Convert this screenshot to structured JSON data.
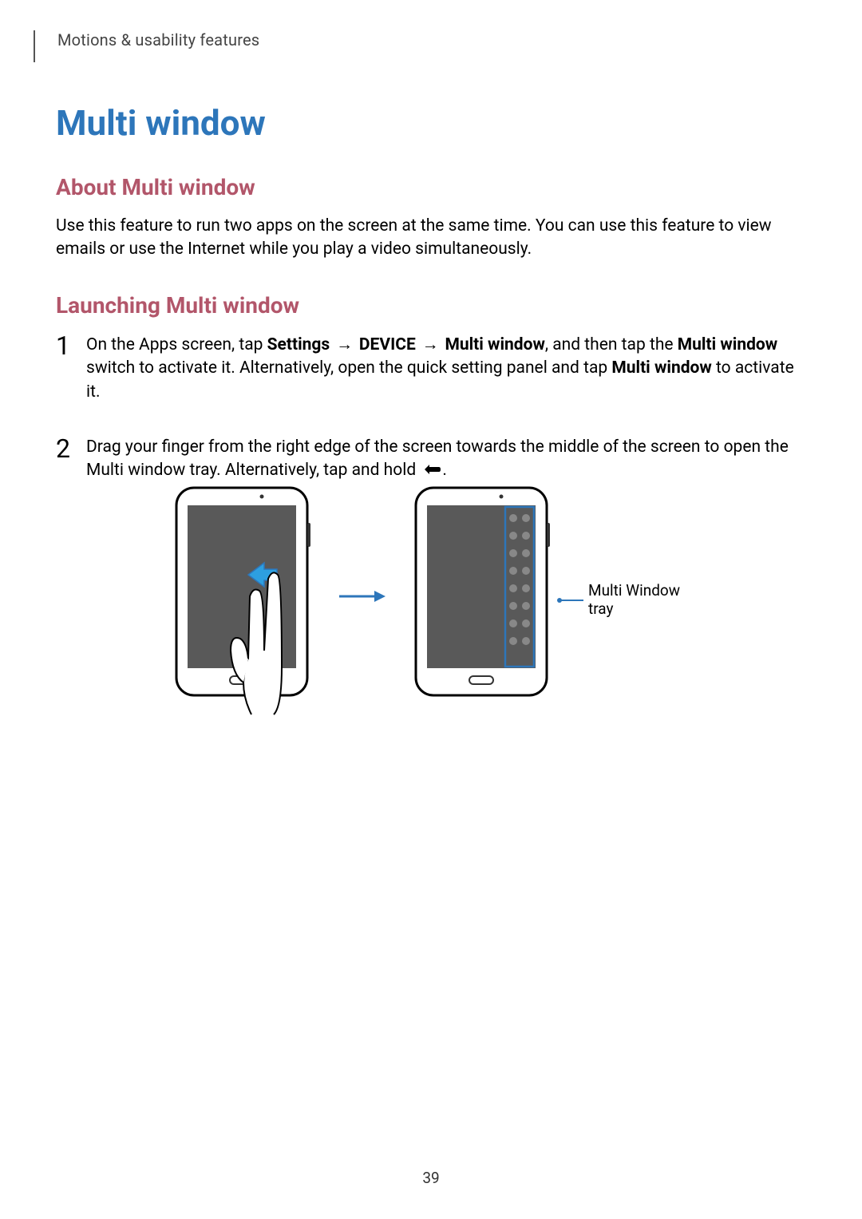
{
  "header": {
    "breadcrumb": "Motions & usability features"
  },
  "title": "Multi window",
  "sections": {
    "about": {
      "heading": "About Multi window",
      "body": "Use this feature to run two apps on the screen at the same time. You can use this feature to view emails or use the Internet while you play a video simultaneously."
    },
    "launching": {
      "heading": "Launching Multi window",
      "steps": {
        "s1": {
          "t0": "On the Apps screen, tap ",
          "b0": "Settings",
          "t1": " → ",
          "b1": "DEVICE",
          "t2": " → ",
          "b2": "Multi window",
          "t3": ", and then tap the ",
          "b3": "Multi window",
          "t4": " switch to activate it. Alternatively, open the quick setting panel and tap ",
          "b4": "Multi window",
          "t5": " to activate it."
        },
        "s2": {
          "t0": "Drag your finger from the right edge of the screen towards the middle of the screen to open the Multi window tray. Alternatively, tap and hold ",
          "t1": "."
        }
      }
    }
  },
  "illustration": {
    "callout": "Multi Window tray"
  },
  "page_number": "39"
}
